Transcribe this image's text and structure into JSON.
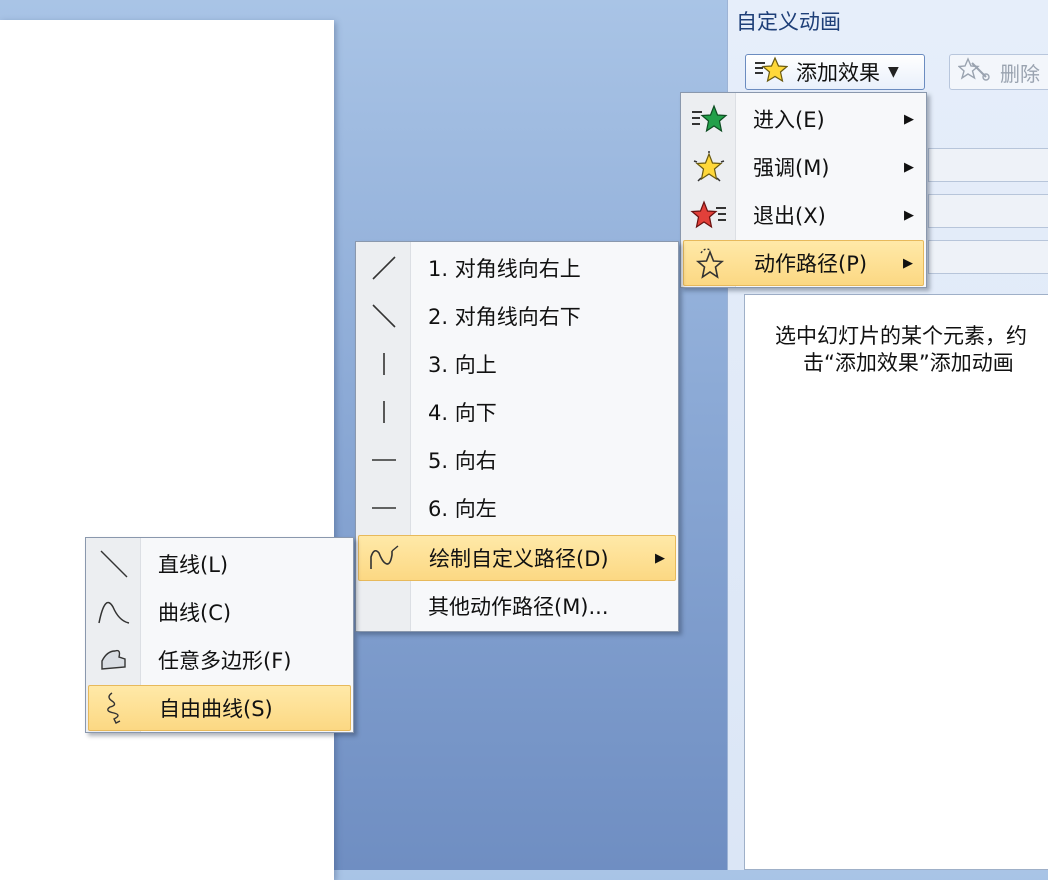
{
  "task_pane": {
    "title": "自定义动画",
    "add_effect_label": "添加效果",
    "delete_label": "删除",
    "hint_line1": "选中幻灯片的某个元素，约",
    "hint_line2": "击“添加效果”添加动画"
  },
  "effect_menu": [
    {
      "label": "进入(E)",
      "icon": "star-green-entrance-icon"
    },
    {
      "label": "强调(M)",
      "icon": "star-yellow-emphasis-icon"
    },
    {
      "label": "退出(X)",
      "icon": "star-red-exit-icon"
    },
    {
      "label": "动作路径(P)",
      "icon": "star-motion-path-icon",
      "highlighted": true
    }
  ],
  "path_menu": [
    {
      "label": "1. 对角线向右上",
      "icon": "diagonal-up-right-icon"
    },
    {
      "label": "2. 对角线向右下",
      "icon": "diagonal-down-right-icon"
    },
    {
      "label": "3. 向上",
      "icon": "line-up-icon"
    },
    {
      "label": "4. 向下",
      "icon": "line-down-icon"
    },
    {
      "label": "5. 向右",
      "icon": "line-right-icon"
    },
    {
      "label": "6. 向左",
      "icon": "line-left-icon"
    },
    {
      "label": "绘制自定义路径(D)",
      "icon": "custom-path-icon",
      "highlighted": true
    },
    {
      "label": "其他动作路径(M)...",
      "icon": ""
    }
  ],
  "draw_menu": [
    {
      "label": "直线(L)",
      "icon": "straight-line-icon"
    },
    {
      "label": "曲线(C)",
      "icon": "curve-icon"
    },
    {
      "label": "任意多边形(F)",
      "icon": "freeform-polygon-icon"
    },
    {
      "label": "自由曲线(S)",
      "icon": "scribble-icon",
      "highlighted": true
    }
  ],
  "colors": {
    "highlight": "#fcd883",
    "highlight_border": "#e7b95b",
    "pane_title": "#1e3f78"
  }
}
